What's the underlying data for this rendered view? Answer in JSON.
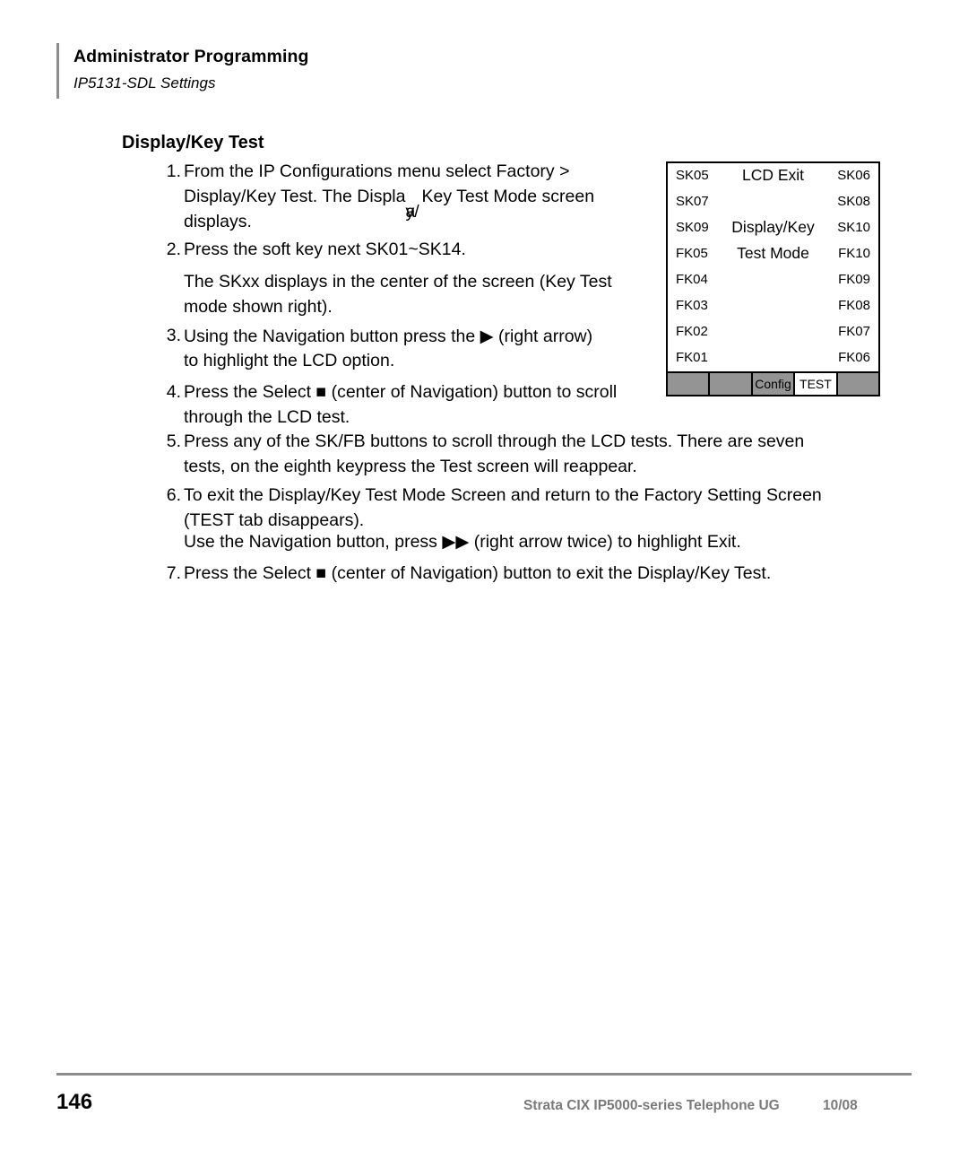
{
  "header": {
    "title": "Administrator Programming",
    "subtitle": "IP5131-SDL Settings"
  },
  "section": {
    "heading": "Display/Key Test"
  },
  "steps": [
    {
      "number": "1.",
      "lines": [
        "From the IP Configurations menu select Factory >",
        "Display/Key Test. The Display/Key Test Mode screen",
        "displays."
      ],
      "overlap_line_index": 1,
      "overlap_prefix": "Display/Key Test. The Displa",
      "overlap_a": "y/",
      "overlap_b": "a",
      "overlap_suffix": "Key Test Mode screen"
    },
    {
      "number": "2.",
      "lines": [
        "Press the soft key next SK01~SK14."
      ]
    },
    {
      "number": "3.",
      "lines": [
        "Using the Navigation button press the ▶ (right arrow)",
        "to highlight the LCD option."
      ]
    },
    {
      "number": "4.",
      "lines": [
        "Press the Select ■ (center of Navigation) button to scroll",
        "through the LCD test."
      ]
    },
    {
      "number": "5.",
      "lines": [
        "Press any of the SK/FB buttons to scroll through the LCD tests. There are seven",
        "tests, on the eighth keypress the Test screen will reappear."
      ]
    },
    {
      "number": "6.",
      "lines": [
        "To exit the Display/Key Test Mode Screen and return to the Factory Setting Screen",
        "(TEST tab disappears).",
        "Use the Navigation button, press ▶▶ (right arrow twice) to highlight Exit."
      ]
    },
    {
      "number": "7.",
      "lines": [
        "Press the Select ■ (center of Navigation) button to exit the Display/Key Test."
      ]
    }
  ],
  "paragraph": {
    "lines": [
      "The SKxx displays in the center of the screen (Key Test",
      "mode shown right)."
    ]
  },
  "lcd": {
    "rows": [
      {
        "left": "SK05",
        "right": "SK06",
        "center": "LCD Exit"
      },
      {
        "left": "SK07",
        "right": "SK08",
        "center": ""
      },
      {
        "left": "SK09",
        "right": "SK10",
        "center": "Display/Key"
      },
      {
        "left": "FK05",
        "right": "FK10",
        "center": "Test Mode"
      },
      {
        "left": "FK04",
        "right": "FK09",
        "center": ""
      },
      {
        "left": "FK03",
        "right": "FK08",
        "center": ""
      },
      {
        "left": "FK02",
        "right": "FK07",
        "center": ""
      },
      {
        "left": "FK01",
        "right": "FK06",
        "center": ""
      }
    ],
    "tabs": [
      {
        "label": "",
        "active": false
      },
      {
        "label": "",
        "active": false
      },
      {
        "label": "Config",
        "active": false
      },
      {
        "label": "TEST",
        "active": true
      },
      {
        "label": "",
        "active": false
      }
    ],
    "colors": {
      "tab_inactive": "#949494",
      "tab_active": "#ffffff",
      "border": "#000000"
    }
  },
  "footer": {
    "page_number": "146",
    "document": "Strata CIX IP5000-series Telephone UG",
    "date": "10/08",
    "rule_color": "#8c8c8c"
  },
  "glyphs": {
    "right_arrow": "▶",
    "select_square": "■"
  }
}
